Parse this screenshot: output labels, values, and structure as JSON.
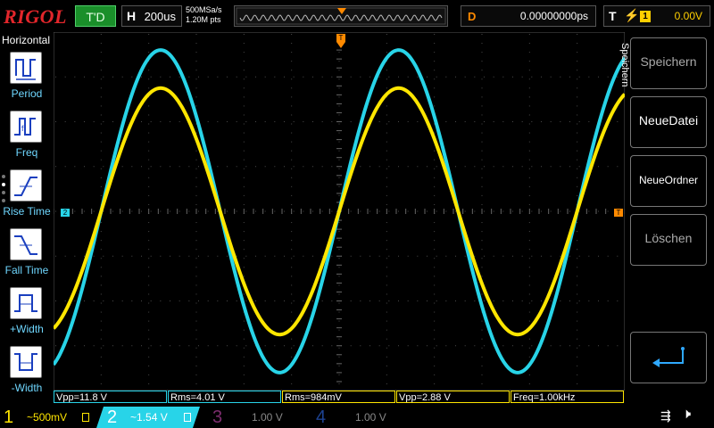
{
  "header": {
    "logo": "RIGOL",
    "run_status": "T'D",
    "timebase_key": "H",
    "timebase_value": "200us",
    "sample_rate": "500MSa/s",
    "memory_depth": "1.20M pts",
    "delay_key": "D",
    "delay_value": "0.00000000ps",
    "trigger_key": "T",
    "trigger_source": "1",
    "trigger_level": "0.00V"
  },
  "left_panel": {
    "title": "Horizontal",
    "items": [
      {
        "label": "Period",
        "icon": "period-icon"
      },
      {
        "label": "Freq",
        "icon": "frequency-icon"
      },
      {
        "label": "Rise Time",
        "icon": "rise-time-icon"
      },
      {
        "label": "Fall Time",
        "icon": "fall-time-icon"
      },
      {
        "label": "+Width",
        "icon": "positive-width-icon"
      },
      {
        "label": "-Width",
        "icon": "negative-width-icon"
      }
    ]
  },
  "right_panel": {
    "title": "Speichern",
    "buttons": [
      {
        "label": "Speichern"
      },
      {
        "label": "NeueDatei"
      },
      {
        "label": "NeueOrdner"
      },
      {
        "label": "Löschen"
      },
      {
        "label": ""
      }
    ]
  },
  "markers": {
    "ch2_ground": "2",
    "trigger_position": "T"
  },
  "measurements": [
    {
      "text": "Vpp=11.8 V",
      "color": "#28d4e8"
    },
    {
      "text": "Rms=4.01 V",
      "color": "#28d4e8"
    },
    {
      "text": "Rms=984mV",
      "color": "#ffe600"
    },
    {
      "text": "Vpp=2.88 V",
      "color": "#ffe600"
    },
    {
      "text": "Freq=1.00kHz",
      "color": "#ffe600"
    }
  ],
  "channels": [
    {
      "num": "1",
      "coupling": "~",
      "scale": "500mV",
      "color": "#ffe600",
      "active": true
    },
    {
      "num": "2",
      "coupling": "~",
      "scale": "1.54 V",
      "color": "#28d4e8",
      "active": true
    },
    {
      "num": "3",
      "coupling": "",
      "scale": "1.00 V",
      "color": "#d04ab8",
      "active": false
    },
    {
      "num": "4",
      "coupling": "",
      "scale": "1.00 V",
      "color": "#2a5fcf",
      "active": false
    }
  ],
  "waveforms": {
    "ch1": {
      "color": "#ffe600",
      "frequency_hz": 1000,
      "vpp": 2.88
    },
    "ch2": {
      "color": "#28d4e8",
      "frequency_hz": 1000,
      "vpp": 11.8
    }
  }
}
